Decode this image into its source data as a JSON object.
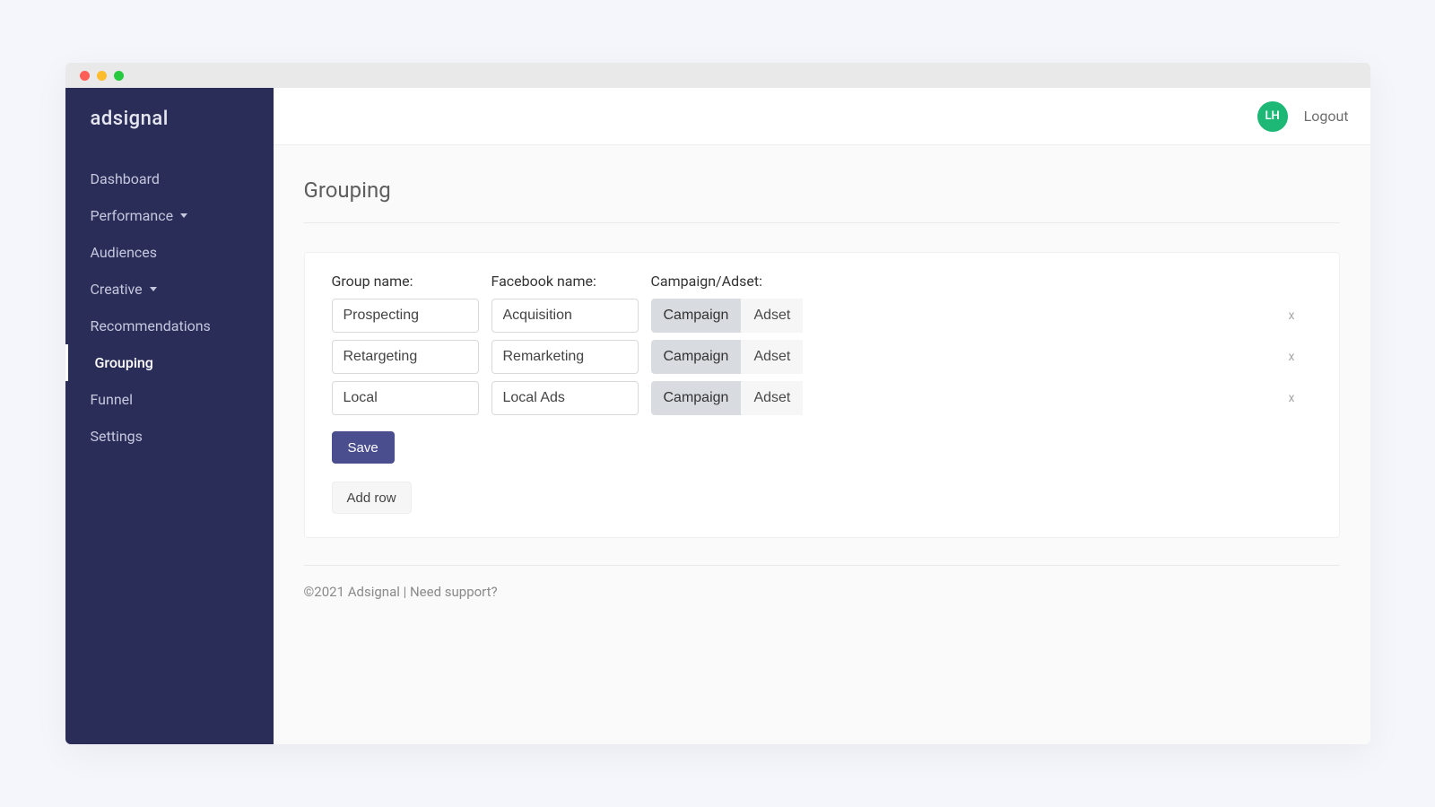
{
  "brand": "adsignal",
  "sidebar": {
    "items": [
      {
        "label": "Dashboard",
        "has_caret": false,
        "active": false
      },
      {
        "label": "Performance",
        "has_caret": true,
        "active": false
      },
      {
        "label": "Audiences",
        "has_caret": false,
        "active": false
      },
      {
        "label": "Creative",
        "has_caret": true,
        "active": false
      },
      {
        "label": "Recommendations",
        "has_caret": false,
        "active": false
      },
      {
        "label": "Grouping",
        "has_caret": false,
        "active": true
      },
      {
        "label": "Funnel",
        "has_caret": false,
        "active": false
      },
      {
        "label": "Settings",
        "has_caret": false,
        "active": false
      }
    ]
  },
  "topbar": {
    "avatar_initials": "LH",
    "logout_label": "Logout"
  },
  "page": {
    "title": "Grouping"
  },
  "columns": {
    "group_name": "Group name:",
    "facebook_name": "Facebook name:",
    "campaign_adset": "Campaign/Adset:"
  },
  "toggle_labels": {
    "campaign": "Campaign",
    "adset": "Adset"
  },
  "rows": [
    {
      "group_name": "Prospecting",
      "facebook_name": "Acquisition",
      "selected": "campaign"
    },
    {
      "group_name": "Retargeting",
      "facebook_name": "Remarketing",
      "selected": "campaign"
    },
    {
      "group_name": "Local",
      "facebook_name": "Local Ads",
      "selected": "campaign"
    }
  ],
  "remove_label": "x",
  "save_label": "Save",
  "add_row_label": "Add row",
  "footer": {
    "copyright": "©2021 Adsignal | ",
    "support": "Need support?"
  }
}
